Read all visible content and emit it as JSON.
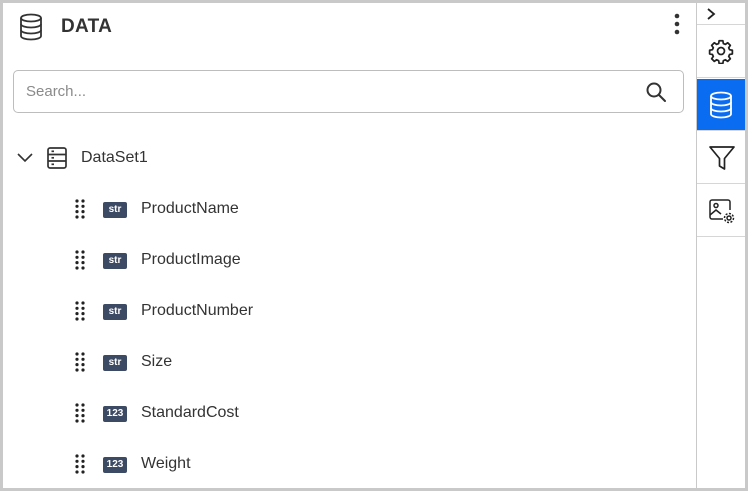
{
  "panel": {
    "title": "DATA",
    "header_icon": "database-icon",
    "menu_icon": "more-vertical-icon"
  },
  "search": {
    "placeholder": "Search...",
    "value": "",
    "icon": "search-icon"
  },
  "tree": {
    "dataset": {
      "label": "DataSet1",
      "expanded": true,
      "icon": "server-icon"
    },
    "fields": [
      {
        "label": "ProductName",
        "type": "str"
      },
      {
        "label": "ProductImage",
        "type": "str"
      },
      {
        "label": "ProductNumber",
        "type": "str"
      },
      {
        "label": "Size",
        "type": "str"
      },
      {
        "label": "StandardCost",
        "type": "123"
      },
      {
        "label": "Weight",
        "type": "123"
      }
    ]
  },
  "toolbar": {
    "items": [
      {
        "name": "properties",
        "icon": "gear-icon",
        "active": false
      },
      {
        "name": "data",
        "icon": "database-icon",
        "active": true
      },
      {
        "name": "filter",
        "icon": "filter-icon",
        "active": false
      },
      {
        "name": "image-settings",
        "icon": "image-settings-icon",
        "active": false
      }
    ]
  },
  "colors": {
    "active_accent": "#0a6cf0",
    "badge_bg": "#3d4a63",
    "border": "#c9c9c9"
  }
}
